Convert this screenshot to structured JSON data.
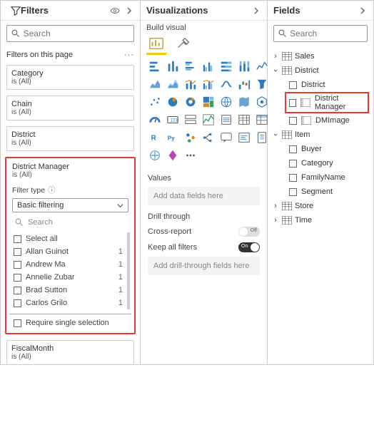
{
  "filters_pane": {
    "title": "Filters",
    "search_placeholder": "Search",
    "section_label": "Filters on this page",
    "cards": [
      {
        "name": "Category",
        "state": "is (All)"
      },
      {
        "name": "Chain",
        "state": "is (All)"
      },
      {
        "name": "District",
        "state": "is (All)"
      }
    ],
    "expanded": {
      "name": "District Manager",
      "state": "is (All)",
      "filter_type_label": "Filter type",
      "filter_type_value": "Basic filtering",
      "inner_search_placeholder": "Search",
      "items": [
        {
          "name": "Select all",
          "count": ""
        },
        {
          "name": "Allan Guinot",
          "count": "1"
        },
        {
          "name": "Andrew Ma",
          "count": "1"
        },
        {
          "name": "Annelie Zubar",
          "count": "1"
        },
        {
          "name": "Brad Sutton",
          "count": "1"
        },
        {
          "name": "Carlos Grilo",
          "count": "1"
        }
      ],
      "require_single": "Require single selection"
    },
    "extra_card": {
      "name": "FiscalMonth",
      "state": "is (All)"
    }
  },
  "viz_pane": {
    "title": "Visualizations",
    "subtitle": "Build visual",
    "values_label": "Values",
    "values_placeholder": "Add data fields here",
    "drill_label": "Drill through",
    "cross_report_label": "Cross-report",
    "keep_filters_label": "Keep all filters",
    "drill_placeholder": "Add drill-through fields here"
  },
  "fields_pane": {
    "title": "Fields",
    "search_placeholder": "Search",
    "tables": [
      {
        "name": "Sales",
        "expanded": false
      },
      {
        "name": "District",
        "expanded": true,
        "fields": [
          {
            "name": "District",
            "icon": ""
          },
          {
            "name": "District Manager",
            "icon": "layout",
            "highlight": true
          },
          {
            "name": "DMImage",
            "icon": "layout"
          }
        ]
      },
      {
        "name": "Item",
        "expanded": true,
        "fields": [
          {
            "name": "Buyer"
          },
          {
            "name": "Category"
          },
          {
            "name": "FamilyName"
          },
          {
            "name": "Segment"
          }
        ]
      },
      {
        "name": "Store",
        "expanded": false
      },
      {
        "name": "Time",
        "expanded": false
      }
    ]
  }
}
